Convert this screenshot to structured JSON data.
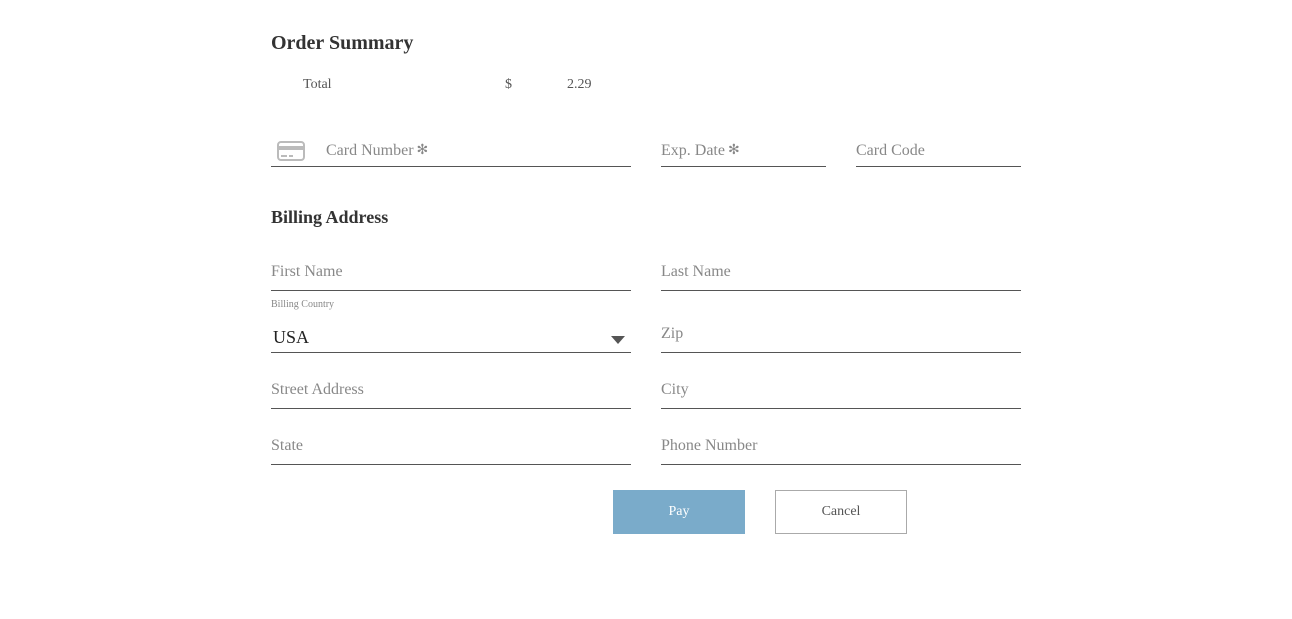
{
  "order_summary": {
    "title": "Order Summary",
    "total_label": "Total",
    "currency": "$",
    "amount": "2.29"
  },
  "card": {
    "number_label": "Card Number",
    "exp_label": "Exp. Date",
    "code_label": "Card Code",
    "required_mark": "✻"
  },
  "billing": {
    "title": "Billing Address",
    "first_name": "First Name",
    "last_name": "Last Name",
    "country_label": "Billing Country",
    "country_value": "USA",
    "zip": "Zip",
    "street": "Street Address",
    "city": "City",
    "state": "State",
    "phone": "Phone Number"
  },
  "buttons": {
    "pay": "Pay",
    "cancel": "Cancel"
  }
}
